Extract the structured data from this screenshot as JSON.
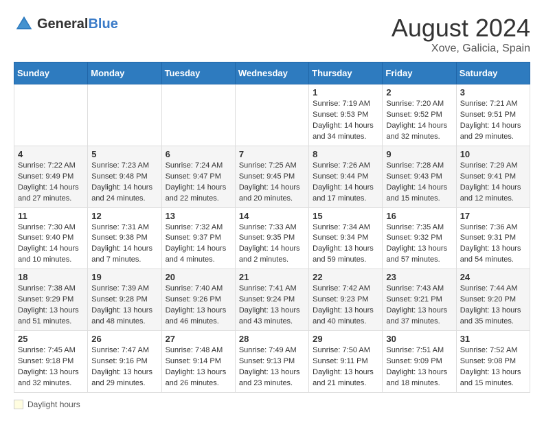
{
  "header": {
    "logo_general": "General",
    "logo_blue": "Blue",
    "month_year": "August 2024",
    "location": "Xove, Galicia, Spain"
  },
  "days_of_week": [
    "Sunday",
    "Monday",
    "Tuesday",
    "Wednesday",
    "Thursday",
    "Friday",
    "Saturday"
  ],
  "weeks": [
    {
      "days": [
        {
          "number": "",
          "info": ""
        },
        {
          "number": "",
          "info": ""
        },
        {
          "number": "",
          "info": ""
        },
        {
          "number": "",
          "info": ""
        },
        {
          "number": "1",
          "info": "Sunrise: 7:19 AM\nSunset: 9:53 PM\nDaylight: 14 hours and 34 minutes."
        },
        {
          "number": "2",
          "info": "Sunrise: 7:20 AM\nSunset: 9:52 PM\nDaylight: 14 hours and 32 minutes."
        },
        {
          "number": "3",
          "info": "Sunrise: 7:21 AM\nSunset: 9:51 PM\nDaylight: 14 hours and 29 minutes."
        }
      ]
    },
    {
      "days": [
        {
          "number": "4",
          "info": "Sunrise: 7:22 AM\nSunset: 9:49 PM\nDaylight: 14 hours and 27 minutes."
        },
        {
          "number": "5",
          "info": "Sunrise: 7:23 AM\nSunset: 9:48 PM\nDaylight: 14 hours and 24 minutes."
        },
        {
          "number": "6",
          "info": "Sunrise: 7:24 AM\nSunset: 9:47 PM\nDaylight: 14 hours and 22 minutes."
        },
        {
          "number": "7",
          "info": "Sunrise: 7:25 AM\nSunset: 9:45 PM\nDaylight: 14 hours and 20 minutes."
        },
        {
          "number": "8",
          "info": "Sunrise: 7:26 AM\nSunset: 9:44 PM\nDaylight: 14 hours and 17 minutes."
        },
        {
          "number": "9",
          "info": "Sunrise: 7:28 AM\nSunset: 9:43 PM\nDaylight: 14 hours and 15 minutes."
        },
        {
          "number": "10",
          "info": "Sunrise: 7:29 AM\nSunset: 9:41 PM\nDaylight: 14 hours and 12 minutes."
        }
      ]
    },
    {
      "days": [
        {
          "number": "11",
          "info": "Sunrise: 7:30 AM\nSunset: 9:40 PM\nDaylight: 14 hours and 10 minutes."
        },
        {
          "number": "12",
          "info": "Sunrise: 7:31 AM\nSunset: 9:38 PM\nDaylight: 14 hours and 7 minutes."
        },
        {
          "number": "13",
          "info": "Sunrise: 7:32 AM\nSunset: 9:37 PM\nDaylight: 14 hours and 4 minutes."
        },
        {
          "number": "14",
          "info": "Sunrise: 7:33 AM\nSunset: 9:35 PM\nDaylight: 14 hours and 2 minutes."
        },
        {
          "number": "15",
          "info": "Sunrise: 7:34 AM\nSunset: 9:34 PM\nDaylight: 13 hours and 59 minutes."
        },
        {
          "number": "16",
          "info": "Sunrise: 7:35 AM\nSunset: 9:32 PM\nDaylight: 13 hours and 57 minutes."
        },
        {
          "number": "17",
          "info": "Sunrise: 7:36 AM\nSunset: 9:31 PM\nDaylight: 13 hours and 54 minutes."
        }
      ]
    },
    {
      "days": [
        {
          "number": "18",
          "info": "Sunrise: 7:38 AM\nSunset: 9:29 PM\nDaylight: 13 hours and 51 minutes."
        },
        {
          "number": "19",
          "info": "Sunrise: 7:39 AM\nSunset: 9:28 PM\nDaylight: 13 hours and 48 minutes."
        },
        {
          "number": "20",
          "info": "Sunrise: 7:40 AM\nSunset: 9:26 PM\nDaylight: 13 hours and 46 minutes."
        },
        {
          "number": "21",
          "info": "Sunrise: 7:41 AM\nSunset: 9:24 PM\nDaylight: 13 hours and 43 minutes."
        },
        {
          "number": "22",
          "info": "Sunrise: 7:42 AM\nSunset: 9:23 PM\nDaylight: 13 hours and 40 minutes."
        },
        {
          "number": "23",
          "info": "Sunrise: 7:43 AM\nSunset: 9:21 PM\nDaylight: 13 hours and 37 minutes."
        },
        {
          "number": "24",
          "info": "Sunrise: 7:44 AM\nSunset: 9:20 PM\nDaylight: 13 hours and 35 minutes."
        }
      ]
    },
    {
      "days": [
        {
          "number": "25",
          "info": "Sunrise: 7:45 AM\nSunset: 9:18 PM\nDaylight: 13 hours and 32 minutes."
        },
        {
          "number": "26",
          "info": "Sunrise: 7:47 AM\nSunset: 9:16 PM\nDaylight: 13 hours and 29 minutes."
        },
        {
          "number": "27",
          "info": "Sunrise: 7:48 AM\nSunset: 9:14 PM\nDaylight: 13 hours and 26 minutes."
        },
        {
          "number": "28",
          "info": "Sunrise: 7:49 AM\nSunset: 9:13 PM\nDaylight: 13 hours and 23 minutes."
        },
        {
          "number": "29",
          "info": "Sunrise: 7:50 AM\nSunset: 9:11 PM\nDaylight: 13 hours and 21 minutes."
        },
        {
          "number": "30",
          "info": "Sunrise: 7:51 AM\nSunset: 9:09 PM\nDaylight: 13 hours and 18 minutes."
        },
        {
          "number": "31",
          "info": "Sunrise: 7:52 AM\nSunset: 9:08 PM\nDaylight: 13 hours and 15 minutes."
        }
      ]
    }
  ],
  "legend": {
    "box_label": "Daylight hours"
  }
}
